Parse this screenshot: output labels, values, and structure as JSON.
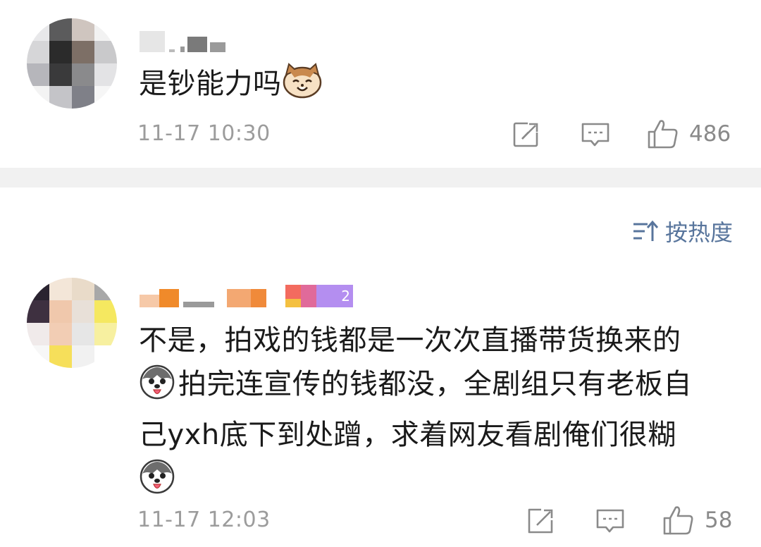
{
  "comments": [
    {
      "text": "是钞能力吗",
      "emoji": "cat-face-emoji",
      "time": "11-17 10:30",
      "likes": "486",
      "username_redacted": "",
      "actions": [
        "share-icon",
        "comment-icon",
        "like-icon"
      ]
    },
    {
      "text_lines": [
        "不是，拍戏的钱都是一次次直播带货换来的",
        "拍完连宣传的钱都没，全剧组只有老板自",
        "己yxh底下到处蹭，求着网友看剧俺们很糊"
      ],
      "emoji": "husky-dog-emoji",
      "time": "11-17 12:03",
      "likes": "58",
      "badge_text": "2"
    }
  ],
  "sort": {
    "label": "按热度",
    "icon": "sort-icon"
  },
  "colors": {
    "link": "#58759c",
    "meta": "#9c9c9c",
    "divider": "#f1f1f1"
  }
}
